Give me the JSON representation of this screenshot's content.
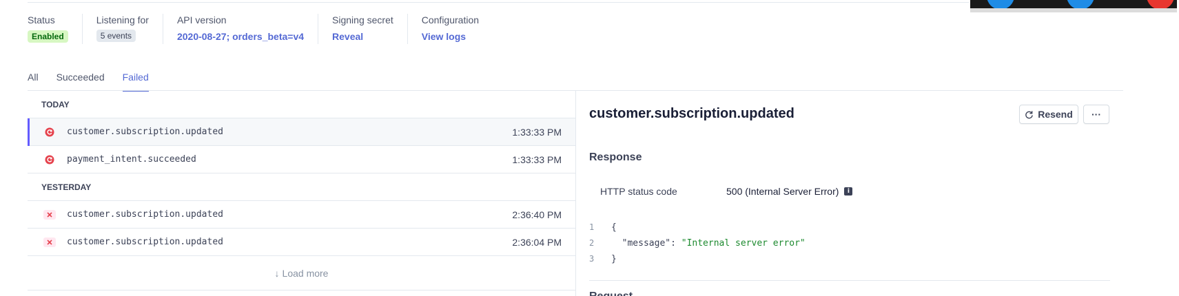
{
  "summary": {
    "status_label": "Status",
    "status_value": "Enabled",
    "listening_label": "Listening for",
    "listening_value": "5 events",
    "api_label": "API version",
    "api_value": "2020-08-27; orders_beta=v4",
    "secret_label": "Signing secret",
    "secret_value": "Reveal",
    "config_label": "Configuration",
    "config_value": "View logs"
  },
  "tabs": [
    {
      "label": "All",
      "active": false
    },
    {
      "label": "Succeeded",
      "active": false
    },
    {
      "label": "Failed",
      "active": true
    }
  ],
  "events": {
    "groups": [
      {
        "header": "TODAY",
        "rows": [
          {
            "name": "customer.subscription.updated",
            "time": "1:33:33 PM",
            "icon": "retry-icon",
            "selected": true
          },
          {
            "name": "payment_intent.succeeded",
            "time": "1:33:33 PM",
            "icon": "retry-icon",
            "selected": false
          }
        ]
      },
      {
        "header": "YESTERDAY",
        "rows": [
          {
            "name": "customer.subscription.updated",
            "time": "2:36:40 PM",
            "icon": "close-icon",
            "selected": false
          },
          {
            "name": "customer.subscription.updated",
            "time": "2:36:04 PM",
            "icon": "close-icon",
            "selected": false
          }
        ]
      }
    ],
    "load_more": "Load more"
  },
  "details": {
    "title": "customer.subscription.updated",
    "resend_label": "Resend",
    "more_label": "···",
    "response_title": "Response",
    "status_code_label": "HTTP status code",
    "status_code_value": "500 (Internal Server Error)",
    "code": {
      "line1_no": "1",
      "line1": "{",
      "line2_no": "2",
      "line2_key": "  \"message\": ",
      "line2_value": "\"Internal server error\"",
      "line3_no": "3",
      "line3": "}"
    },
    "next_section": "Request"
  },
  "colors": {
    "accent": "#5469d4",
    "selected_bar": "#635bff",
    "enabled_bg": "#d7f7c2",
    "error": "#e5424d",
    "json_string": "#1d8a2f"
  }
}
